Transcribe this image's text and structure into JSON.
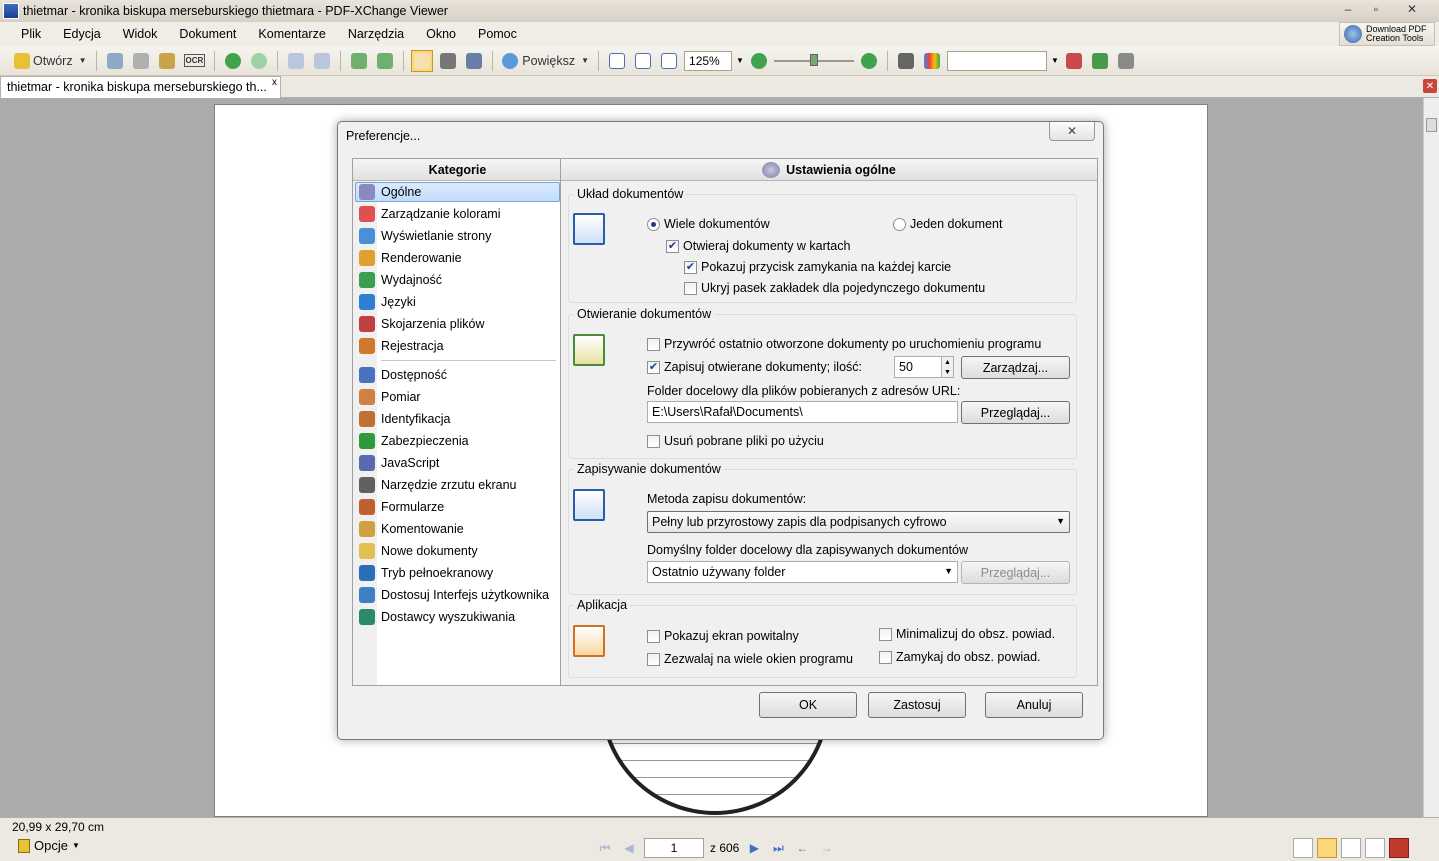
{
  "window": {
    "title": "thietmar - kronika biskupa merseburskiego thietmara - PDF-XChange Viewer",
    "controls": {
      "minimize": "–",
      "restore": "▫",
      "close": "✕"
    }
  },
  "menu": [
    "Plik",
    "Edycja",
    "Widok",
    "Dokument",
    "Komentarze",
    "Narzędzia",
    "Okno",
    "Pomoc"
  ],
  "download_pdf": {
    "line1": "Download PDF",
    "line2": "Creation Tools"
  },
  "toolbar": {
    "open_label": "Otwórz",
    "ocr_label": "OCR",
    "zoom_in_label": "Powiększ",
    "zoom_value": "125%"
  },
  "doc_tab": {
    "label": "thietmar - kronika biskupa merseburskiego th...",
    "close": "x"
  },
  "status": {
    "dimensions": "20,99 x 29,70 cm",
    "options_label": "Opcje",
    "current_page": "1",
    "total_pages": "z 606"
  },
  "dialog": {
    "title": "Preferencje...",
    "close": "✕",
    "categories_header": "Kategorie",
    "categories_top": [
      {
        "label": "Ogólne",
        "icon": "gears-icon",
        "color": "#8a8ac0",
        "selected": true
      },
      {
        "label": "Zarządzanie kolorami",
        "icon": "color-circles-icon",
        "color": "#e05050"
      },
      {
        "label": "Wyświetlanie strony",
        "icon": "magnifier-page-icon",
        "color": "#4a8fd8"
      },
      {
        "label": "Renderowanie",
        "icon": "brush-icon",
        "color": "#e0a030"
      },
      {
        "label": "Wydajność",
        "icon": "chart-icon",
        "color": "#3aa050"
      },
      {
        "label": "Języki",
        "icon": "globe-icon",
        "color": "#2f7fd0"
      },
      {
        "label": "Skojarzenia plików",
        "icon": "file-association-icon",
        "color": "#c04040"
      },
      {
        "label": "Rejestracja",
        "icon": "users-icon",
        "color": "#d07830"
      }
    ],
    "categories_bottom": [
      {
        "label": "Dostępność",
        "icon": "accessibility-icon",
        "color": "#4a70c0"
      },
      {
        "label": "Pomiar",
        "icon": "ruler-icon",
        "color": "#d08040"
      },
      {
        "label": "Identyfikacja",
        "icon": "person-icon",
        "color": "#c07030"
      },
      {
        "label": "Zabezpieczenia",
        "icon": "shield-icon",
        "color": "#2f9a3a"
      },
      {
        "label": "JavaScript",
        "icon": "javascript-icon",
        "color": "#5a6ab0"
      },
      {
        "label": "Narzędzie zrzutu ekranu",
        "icon": "camera-icon",
        "color": "#606060"
      },
      {
        "label": "Formularze",
        "icon": "form-icon",
        "color": "#c06030"
      },
      {
        "label": "Komentowanie",
        "icon": "comment-icon",
        "color": "#d0a040"
      },
      {
        "label": "Nowe dokumenty",
        "icon": "new-document-icon",
        "color": "#e0c050"
      },
      {
        "label": "Tryb pełnoekranowy",
        "icon": "fullscreen-icon",
        "color": "#2a70b8"
      },
      {
        "label": "Dostosuj Interfejs użytkownika",
        "icon": "customize-ui-icon",
        "color": "#4080c0"
      },
      {
        "label": "Dostawcy wyszukiwania",
        "icon": "search-providers-icon",
        "color": "#2a8a6a"
      }
    ],
    "settings_header": "Ustawienia ogólne",
    "layout": {
      "legend": "Układ dokumentów",
      "multi_docs": "Wiele dokumentów",
      "single_doc": "Jeden dokument",
      "open_in_tabs": "Otwieraj dokumenty w kartach",
      "show_close_button": "Pokazuj przycisk zamykania na każdej karcie",
      "hide_tab_bar": "Ukryj pasek zakładek dla pojedynczego dokumentu",
      "multi_docs_selected": true,
      "open_in_tabs_checked": true,
      "show_close_checked": true,
      "hide_tab_bar_checked": false
    },
    "opening": {
      "legend": "Otwieranie dokumentów",
      "restore_last": "Przywróć ostatnio otworzone dokumenty po uruchomieniu programu",
      "save_opened": "Zapisuj otwierane dokumenty; ilość:",
      "count_value": "50",
      "manage_btn": "Zarządzaj...",
      "url_folder_label": "Folder docelowy dla plików pobieranych z adresów URL:",
      "url_folder_value": "E:\\Users\\Rafał\\Documents\\",
      "browse_btn": "Przeglądaj...",
      "delete_downloaded": "Usuń pobrane pliki po użyciu",
      "restore_last_checked": false,
      "save_opened_checked": true,
      "delete_downloaded_checked": false
    },
    "saving": {
      "legend": "Zapisywanie dokumentów",
      "method_label": "Metoda zapisu dokumentów:",
      "method_value": "Pełny lub przyrostowy zapis dla podpisanych cyfrowo",
      "default_folder_label": "Domyślny folder docelowy dla zapisywanych dokumentów",
      "default_folder_value": "Ostatnio używany folder",
      "browse_btn": "Przeglądaj..."
    },
    "app": {
      "legend": "Aplikacja",
      "splash": "Pokazuj ekran powitalny",
      "multi_windows": "Zezwalaj na wiele okien programu",
      "minimize_tray": "Minimalizuj do obsz. powiad.",
      "close_tray": "Zamykaj do obsz. powiad.",
      "splash_checked": false,
      "multi_windows_checked": false,
      "minimize_tray_checked": false,
      "close_tray_checked": false
    },
    "buttons": {
      "ok": "OK",
      "apply": "Zastosuj",
      "cancel": "Anuluj"
    }
  }
}
